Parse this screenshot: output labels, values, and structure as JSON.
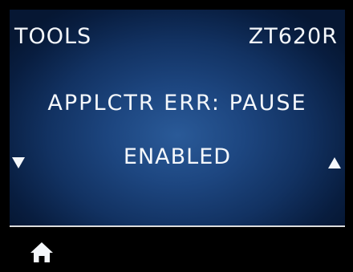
{
  "header": {
    "menu_title": "TOOLS",
    "printer_model": "ZT620R"
  },
  "setting": {
    "name": "APPLCTR ERR: PAUSE",
    "value": "ENABLED"
  },
  "navigation": {
    "previous_icon": "triangle-down-icon",
    "next_icon": "triangle-up-icon"
  },
  "footer": {
    "home_icon": "home-icon"
  },
  "colors": {
    "text": "#f4f7fb",
    "screen_center": "#2a5a98",
    "screen_edge": "#061733",
    "footer_background": "#000000",
    "footer_divider": "#dcdcdc"
  }
}
